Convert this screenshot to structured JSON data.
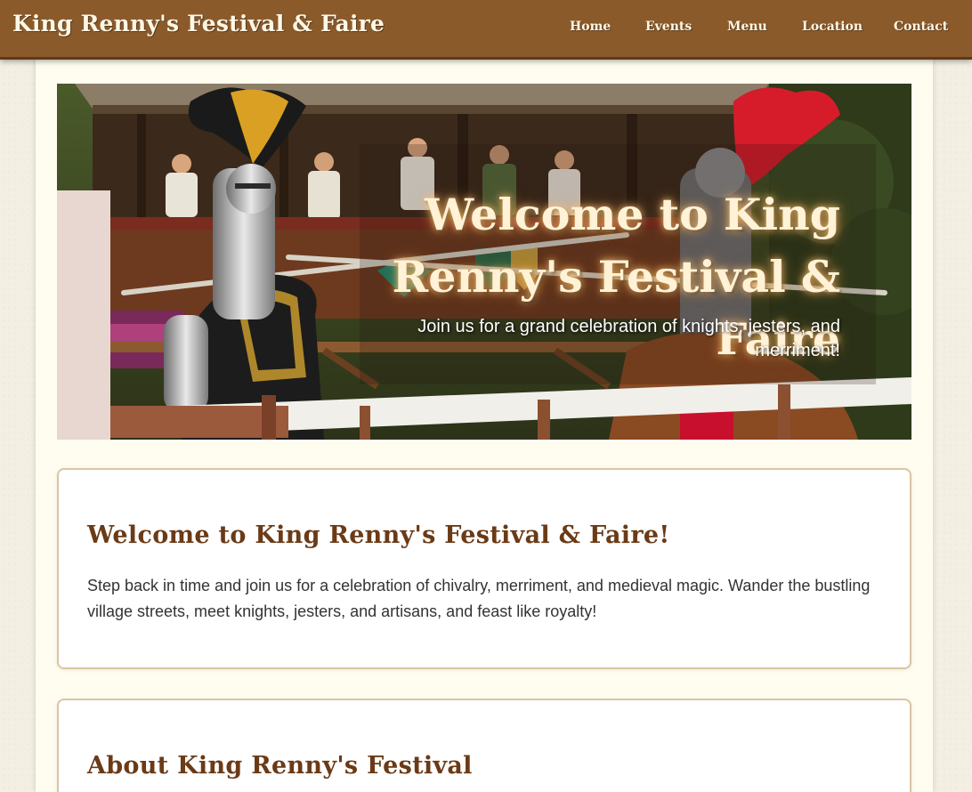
{
  "header": {
    "brand": "King Renny's Festival & Faire",
    "nav": [
      {
        "label": "Home"
      },
      {
        "label": "Events"
      },
      {
        "label": "Menu"
      },
      {
        "label": "Location"
      },
      {
        "label": "Contact"
      }
    ]
  },
  "hero": {
    "title": "Welcome to King Renny's Festival & Faire",
    "subtitle": "Join us for a grand celebration of knights, jesters, and merriment!"
  },
  "welcome": {
    "heading": "Welcome to King Renny's Festival & Faire!",
    "body": "Step back in time and join us for a celebration of chivalry, merriment, and medieval magic. Wander the bustling village streets, meet knights, jesters, and artisans, and feast like royalty!"
  },
  "about": {
    "heading": "About King Renny's Festival"
  },
  "colors": {
    "header_bg": "#8b5a2b",
    "heading_text": "#6b3a16",
    "page_bg": "#fffcf0",
    "card_border": "#d9c6a5"
  }
}
